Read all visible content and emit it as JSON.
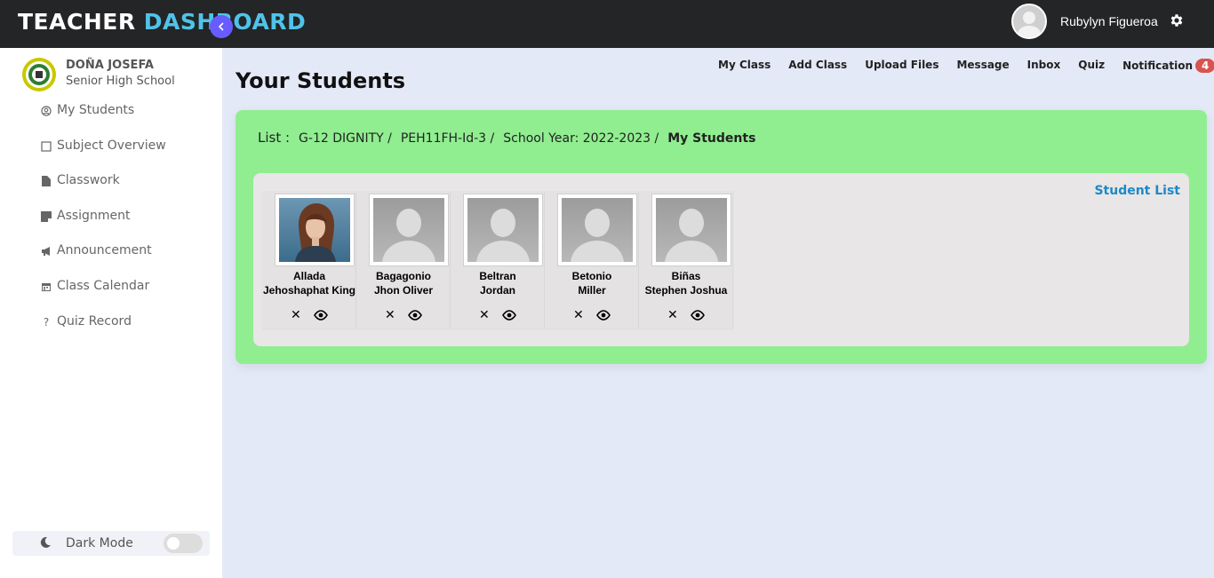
{
  "header": {
    "brand_part1": "TEACHER ",
    "brand_part2": "DASHBOARD",
    "user_name": "Rubylyn Figueroa",
    "settings_icon": "gear-icon"
  },
  "sidebar": {
    "school_line1": "DOÑA JOSEFA",
    "school_line2": "Senior High School",
    "items": [
      {
        "label": "My Students",
        "icon": "user-circle-icon"
      },
      {
        "label": "Subject Overview",
        "icon": "square-icon"
      },
      {
        "label": "Classwork",
        "icon": "file-icon"
      },
      {
        "label": "Assignment",
        "icon": "note-icon"
      },
      {
        "label": "Announcement",
        "icon": "megaphone-icon"
      },
      {
        "label": "Class Calendar",
        "icon": "calendar-icon"
      },
      {
        "label": "Quiz Record",
        "icon": "question-icon"
      }
    ],
    "dark_mode_label": "Dark Mode"
  },
  "main": {
    "title": "Your Students",
    "topnav": [
      "My Class",
      "Add Class",
      "Upload Files",
      "Message",
      "Inbox",
      "Quiz",
      "Notification"
    ],
    "notification_count": "4",
    "crumbs": {
      "label": "List :",
      "grade": "G-12 DIGNITY /",
      "subject": "PEH11FH-Id-3 /",
      "school_year": "School Year: 2022-2023 /",
      "current": "My Students"
    },
    "student_list_link": "Student List",
    "students": [
      {
        "last": "Allada",
        "first": "Jehoshaphat King",
        "has_photo": true
      },
      {
        "last": "Bagagonio",
        "first": "Jhon Oliver",
        "has_photo": false
      },
      {
        "last": "Beltran",
        "first": "Jordan",
        "has_photo": false
      },
      {
        "last": "Betonio",
        "first": "Miller",
        "has_photo": false
      },
      {
        "last": "Biñas",
        "first": "Stephen Joshua",
        "has_photo": false
      }
    ],
    "remove_glyph": "✕"
  },
  "colors": {
    "topbar": "#242526",
    "brand_accent": "#4fc3ea",
    "panel_green": "#90ee90",
    "link_blue": "#1e88c8",
    "badge_red": "#d9534f",
    "toggle_purple": "#695cfe"
  }
}
